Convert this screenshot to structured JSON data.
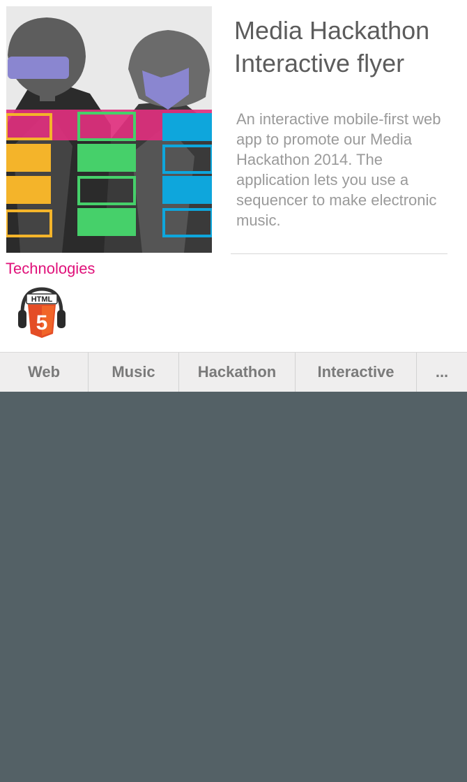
{
  "project": {
    "title_line1": "Media Hackathon",
    "title_line2": "Interactive flyer",
    "description": "An interactive mobile-first web app to promote our Media Hackathon 2014. The application lets you use a sequencer to make electronic music."
  },
  "technologies": {
    "heading": "Technologies",
    "items": [
      {
        "name": "HTML5",
        "icon": "html5-headphones-icon",
        "badge_text": "HTML",
        "badge_number": "5"
      }
    ]
  },
  "tags": [
    "Web",
    "Music",
    "Hackathon",
    "Interactive",
    "..."
  ],
  "colors": {
    "accent": "#e0117a",
    "pink": "#e0307e",
    "yellow": "#f4b42a",
    "green": "#46d06a",
    "blue": "#0ea6dc",
    "html5_orange": "#e44d26",
    "background_dark": "#546166"
  }
}
